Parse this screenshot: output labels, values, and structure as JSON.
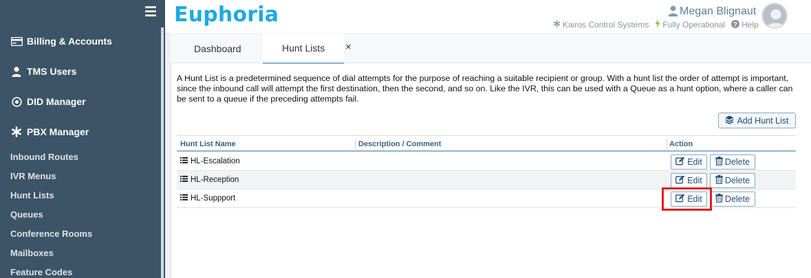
{
  "app": {
    "logo": "Euphoria"
  },
  "user": {
    "name": "Megan Blignaut"
  },
  "status": {
    "company": "Kairos Control Systems",
    "system_state": "Fully Operational",
    "help": "Help"
  },
  "sidebar": {
    "main_items": [
      {
        "label": "Billing & Accounts",
        "icon": "billing-card-icon"
      },
      {
        "label": "TMS Users",
        "icon": "user-icon"
      },
      {
        "label": "DID Manager",
        "icon": "dot-circle-icon"
      },
      {
        "label": "PBX Manager",
        "icon": "asterisk-icon"
      }
    ],
    "sub_items": [
      {
        "label": "Inbound Routes"
      },
      {
        "label": "IVR Menus"
      },
      {
        "label": "Hunt Lists"
      },
      {
        "label": "Queues"
      },
      {
        "label": "Conference Rooms"
      },
      {
        "label": "Mailboxes"
      },
      {
        "label": "Feature Codes"
      }
    ]
  },
  "tabs": [
    {
      "label": "Dashboard",
      "active": false
    },
    {
      "label": "Hunt Lists",
      "active": true
    }
  ],
  "tab_close": "×",
  "page": {
    "description": "A Hunt List is a predetermined sequence of dial attempts for the purpose of reaching a suitable recipient or group. With a hunt list the order of attempt is important, since the inbound call will attempt the first destination, then the second, and so on. Like the IVR, this can be used with a Queue as a hunt option, where a caller can be sent to a queue if the preceding attempts fail.",
    "add_button": "Add Hunt List"
  },
  "table": {
    "columns": [
      "Hunt List Name",
      "Description / Comment",
      "Action"
    ],
    "rows": [
      {
        "name": "HL-Escalation",
        "description": ""
      },
      {
        "name": "HL-Reception",
        "description": ""
      },
      {
        "name": "HL-Suppport",
        "description": ""
      }
    ],
    "edit_label": "Edit",
    "delete_label": "Delete"
  },
  "colors": {
    "sidebar_bg": "#3c5566",
    "brand": "#1ea9e1",
    "button_text": "#1f4e79",
    "highlight": "#e02020"
  }
}
